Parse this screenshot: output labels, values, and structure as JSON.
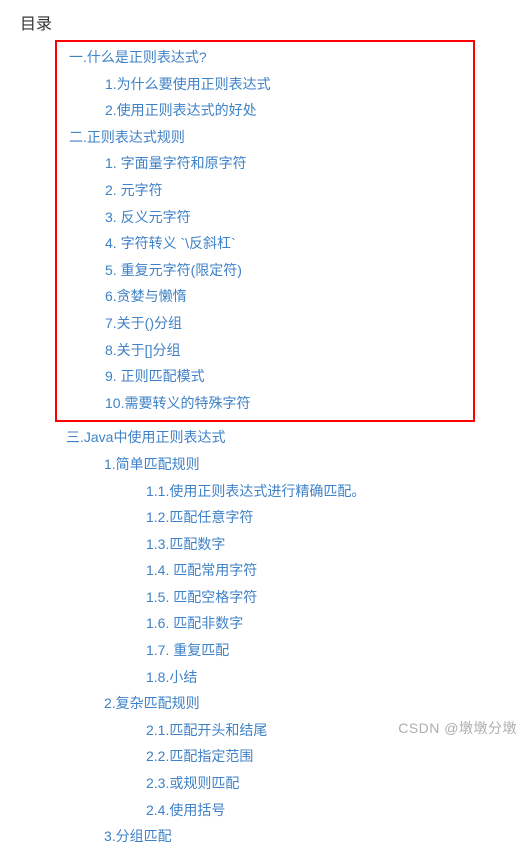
{
  "title": "目录",
  "watermark": "CSDN @墩墩分墩",
  "box": {
    "s1": {
      "label": "一.什么是正则表达式?",
      "c": [
        "1.为什么要使用正则表达式",
        "2.使用正则表达式的好处"
      ]
    },
    "s2": {
      "label": "二.正则表达式规则",
      "c": [
        "1. 字面量字符和原字符",
        "2. 元字符",
        "3. 反义元字符",
        "4. 字符转义 `\\反斜杠`",
        "5. 重复元字符(限定符)",
        "6.贪婪与懒惰",
        "7.关于()分组",
        "8.关于[]分组",
        "9. 正则匹配模式",
        "10.需要转义的特殊字符"
      ]
    }
  },
  "s3": {
    "label": "三.Java中使用正则表达式",
    "sub1": {
      "label": "1.简单匹配规则",
      "c": [
        "1.1.使用正则表达式进行精确匹配。",
        "1.2.匹配任意字符",
        "1.3.匹配数字",
        "1.4. 匹配常用字符",
        "1.5. 匹配空格字符",
        "1.6. 匹配非数字",
        "1.7. 重复匹配",
        "1.8.小结"
      ]
    },
    "sub2": {
      "label": "2.复杂匹配规则",
      "c": [
        "2.1.匹配开头和结尾",
        "2.2.匹配指定范围",
        "2.3.或规则匹配",
        "2.4.使用括号"
      ]
    },
    "sub3": {
      "label": "3.分组匹配"
    }
  }
}
